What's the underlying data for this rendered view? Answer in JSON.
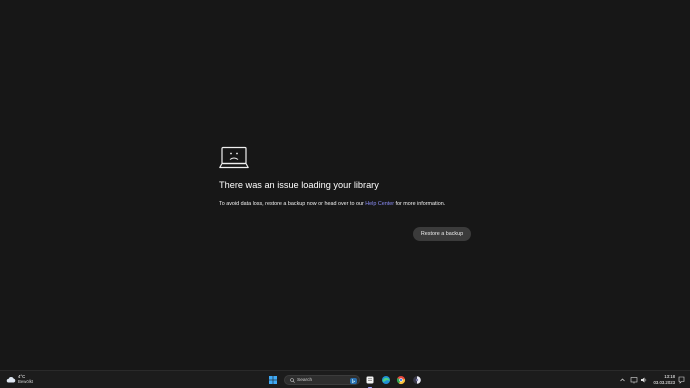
{
  "error": {
    "icon": "sad-laptop-icon",
    "title": "There was an issue loading your library",
    "message_before": "To avoid data loss, restore a backup now or head over to our",
    "link_text": "Help Center",
    "message_after": "for more information.",
    "button_label": "Restore a backup"
  },
  "taskbar": {
    "weather_temp": "4°C",
    "weather_condition": "Bewölkt",
    "search_placeholder": "Search",
    "apps": [
      "windows-start-icon",
      "search",
      "notes-app-icon",
      "edge-browser-icon",
      "chrome-browser-icon",
      "app-icon"
    ],
    "clock_time": "13:18",
    "clock_date": "03.03.2023"
  },
  "colors": {
    "background": "#171717",
    "link": "#8a8cf5",
    "button": "#3b3b3b",
    "taskbar": "#1c1c1c"
  }
}
